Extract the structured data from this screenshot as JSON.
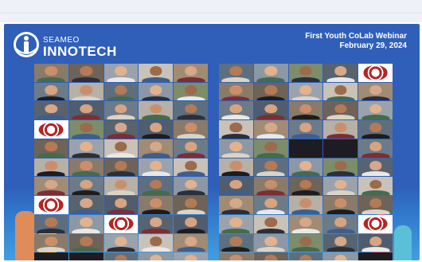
{
  "header": {
    "org": "SEAMEO",
    "name": "INNOTECH",
    "event_title": "First Youth CoLab Webinar",
    "event_date": "February 29, 2024"
  },
  "colors": {
    "banner_bg": "#2f5fb9",
    "text": "#ffffff",
    "accent_red": "#b42525"
  },
  "icons": [
    "innotech-logo-icon",
    "participant-tile",
    "university-seal-icon"
  ]
}
